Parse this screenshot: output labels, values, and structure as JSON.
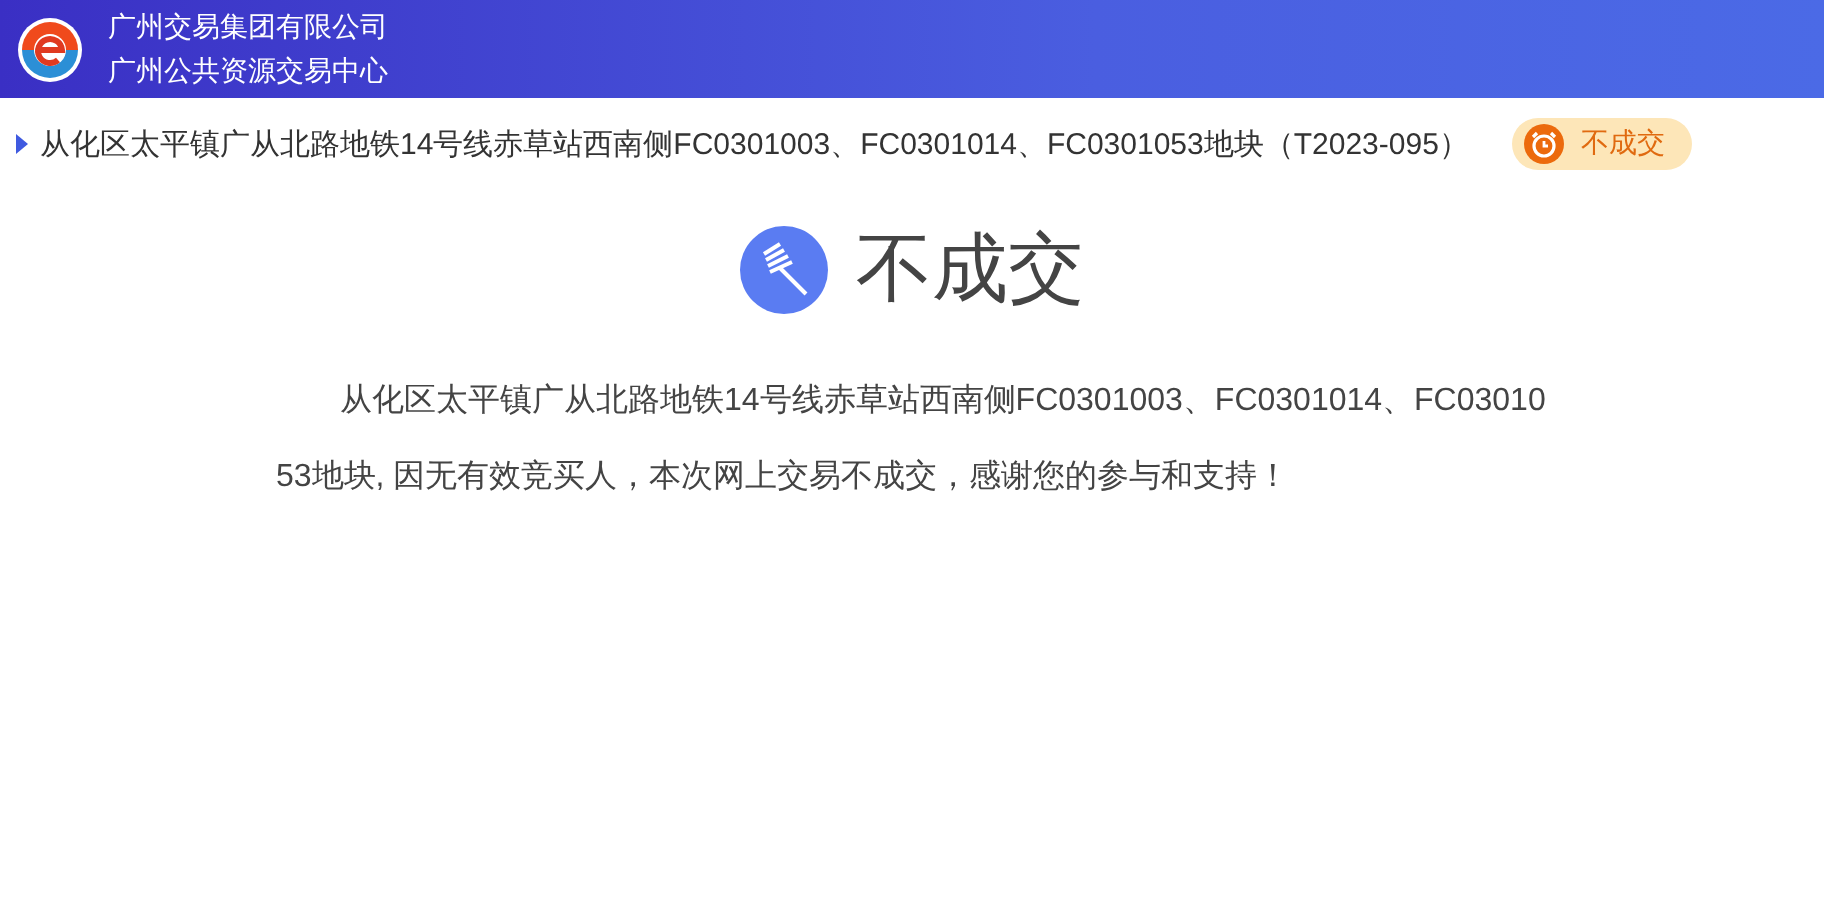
{
  "header": {
    "org_name": "广州交易集团有限公司",
    "center_name": "广州公共资源交易中心"
  },
  "title_bar": {
    "title": "从化区太平镇广从北路地铁14号线赤草站西南侧FC0301003、FC0301014、FC0301053地块（T2023-095）",
    "status": "不成交"
  },
  "result": {
    "heading": "不成交",
    "message": "从化区太平镇广从北路地铁14号线赤草站西南侧FC0301003、FC0301014、FC0301053地块, 因无有效竞买人，本次网上交易不成交，感谢您的参与和支持！"
  }
}
